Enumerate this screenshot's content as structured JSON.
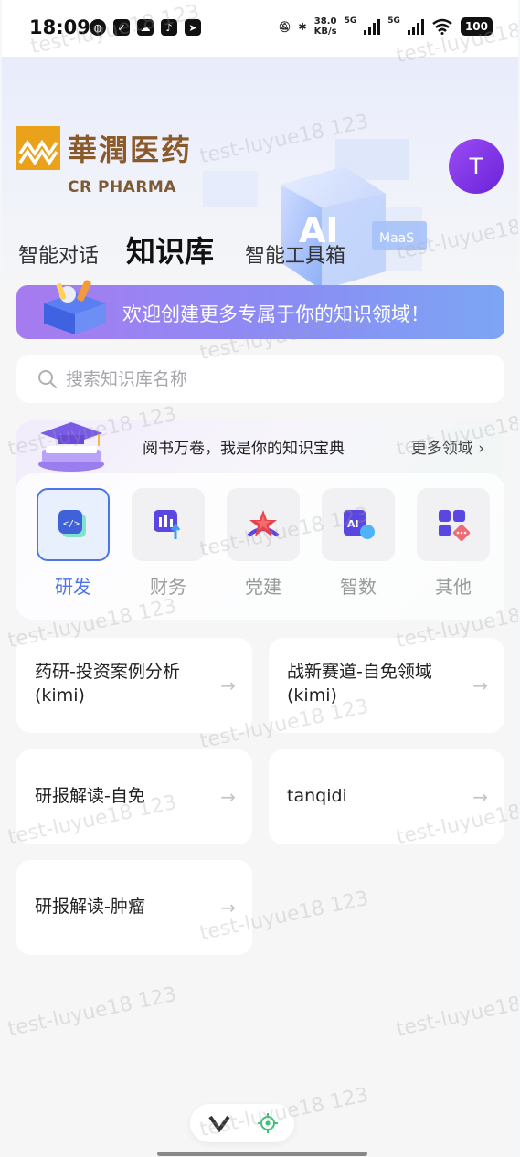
{
  "status_bar": {
    "time": "18:09",
    "speed_value": "38.0",
    "speed_unit": "KB/s",
    "sim1_label": "5G",
    "sim2_label": "5G",
    "battery": "100"
  },
  "brand": {
    "name_cn": "華潤医药",
    "name_en": "CR PHARMA",
    "accent": "#e9a21a"
  },
  "avatar": {
    "initial": "T"
  },
  "tabs": [
    {
      "label": "智能对话",
      "active": false
    },
    {
      "label": "知识库",
      "active": true
    },
    {
      "label": "智能工具箱",
      "active": false
    }
  ],
  "banner": {
    "text": "欢迎创建更多专属于你的知识领域！"
  },
  "search": {
    "placeholder": "搜索知识库名称"
  },
  "knowledge": {
    "slogan": "阅书万卷，我是你的知识宝典",
    "more_label": "更多领域 ›",
    "domains": [
      {
        "label": "研发",
        "icon": "code-icon",
        "active": true
      },
      {
        "label": "财务",
        "icon": "finance-chart-icon",
        "active": false
      },
      {
        "label": "党建",
        "icon": "party-star-icon",
        "active": false
      },
      {
        "label": "智数",
        "icon": "ai-data-icon",
        "active": false
      },
      {
        "label": "其他",
        "icon": "apps-grid-icon",
        "active": false
      }
    ]
  },
  "kb_items": [
    {
      "title": "药研-投资案例分析(kimi)"
    },
    {
      "title": "战新赛道-自免领域(kimi)"
    },
    {
      "title": "研报解读-自免"
    },
    {
      "title": "tanqidi"
    },
    {
      "title": "研报解读-肿瘤"
    }
  ],
  "watermark": "test-luyue18 123",
  "colors": {
    "primary": "#4f74e8",
    "avatar": "#8a3bec",
    "banner_start": "#a67bf0",
    "banner_end": "#7ca6f4"
  }
}
